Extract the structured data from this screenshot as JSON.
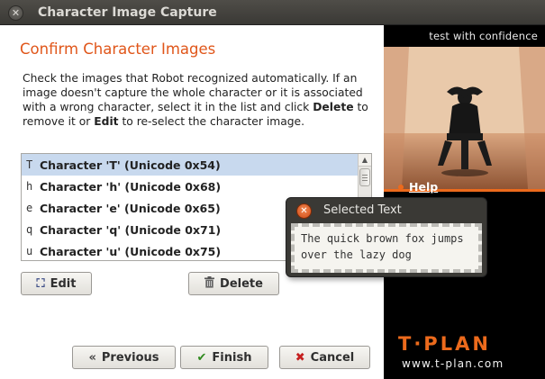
{
  "window": {
    "title": "Character Image Capture"
  },
  "content": {
    "heading": "Confirm Character Images",
    "instructions": {
      "part1": "Check the images that Robot recognized automatically. If an image doesn't capture the whole character or it is associated with a wrong character, select it in the list and click ",
      "delete_word": "Delete",
      "part2": " to remove it or ",
      "edit_word": "Edit",
      "part3": " to re-select the character image."
    }
  },
  "list": {
    "items": [
      {
        "glyph": "T",
        "label": "Character 'T' (Unicode 0x54)",
        "selected": true
      },
      {
        "glyph": "h",
        "label": "Character 'h' (Unicode 0x68)",
        "selected": false
      },
      {
        "glyph": "e",
        "label": "Character 'e' (Unicode 0x65)",
        "selected": false
      },
      {
        "glyph": "q",
        "label": "Character 'q' (Unicode 0x71)",
        "selected": false
      },
      {
        "glyph": "u",
        "label": "Character 'u' (Unicode 0x75)",
        "selected": false
      }
    ]
  },
  "buttons": {
    "edit": "Edit",
    "delete": "Delete",
    "previous": "Previous",
    "finish": "Finish",
    "cancel": "Cancel"
  },
  "sidepanel": {
    "tagline": "test with confidence",
    "help": "Help",
    "logo": "T·PLAN",
    "url": "www.t-plan.com"
  },
  "popup": {
    "title": "Selected Text",
    "text_line1": "The quick brown fox jumps",
    "text_line2": "over the lazy dog"
  },
  "colors": {
    "accent_orange": "#e0561a",
    "selection": "#c8d9ee",
    "titlebar": "#3a3935"
  }
}
